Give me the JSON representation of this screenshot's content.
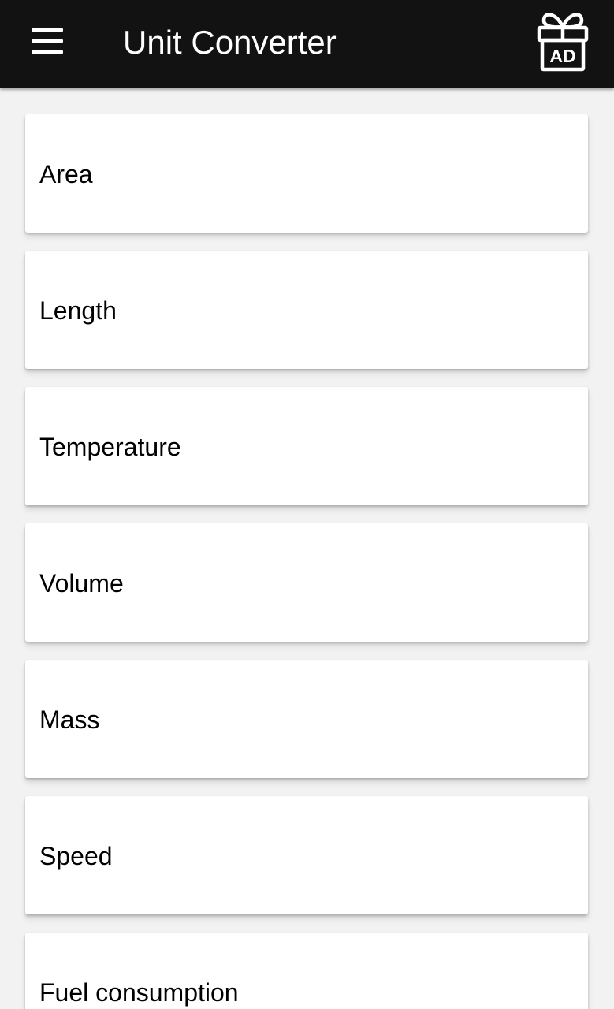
{
  "app_bar": {
    "title": "Unit Converter",
    "menu_icon": "hamburger-menu-icon",
    "ad_icon": "gift-ad-icon",
    "ad_label": "AD",
    "background": "#121212",
    "foreground": "#ffffff"
  },
  "categories": [
    {
      "label": "Area"
    },
    {
      "label": "Length"
    },
    {
      "label": "Temperature"
    },
    {
      "label": "Volume"
    },
    {
      "label": "Mass"
    },
    {
      "label": "Speed"
    },
    {
      "label": "Fuel consumption"
    }
  ],
  "colors": {
    "card": "#ffffff",
    "list_background": "#f2f2f2",
    "text": "#000000"
  }
}
